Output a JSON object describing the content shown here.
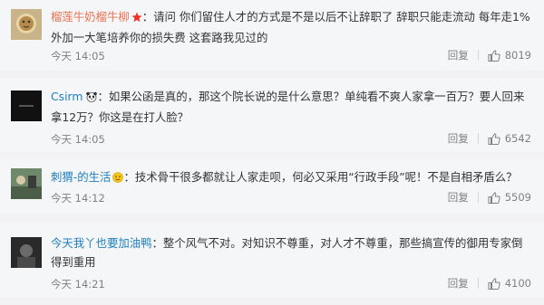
{
  "comments": [
    {
      "username": "榴莲牛奶榴牛柳",
      "badge_icon": "star-icon",
      "text": "请问 你们留住人才的方式是不是以后不让辞职了 辞职只能走流动 每年走1%外加一大笔培养你的损失费 这套路我见过的",
      "time": "今天 14:05",
      "reply_label": "回复",
      "likes": "8019"
    },
    {
      "username": "Csirm",
      "badge_icon": "panda-icon",
      "text": "如果公函是真的，那这个院长说的是什么意思？单纯看不爽人家拿一百万？要人回来拿12万？你这是在打人脸？",
      "time": "今天 14:05",
      "reply_label": "回复",
      "likes": "6542"
    },
    {
      "username": "刺猬-的生活",
      "badge_icon": "face-icon",
      "text": "技术骨干很多都就让人家走呗，何必又采用“行政手段”呢！不是自相矛盾么？",
      "time": "今天 14:12",
      "reply_label": "回复",
      "likes": "5509"
    },
    {
      "username": "今天我丫也要加油鸭",
      "text": "整个风气不对。对知识不尊重，对人才不尊重，那些搞宣传的御用专家倒得到重用",
      "time": "今天 14:21",
      "reply_label": "回复",
      "likes": "4100"
    }
  ],
  "colors": {
    "username_orange": "#eb7350",
    "username_blue": "#1e7fc0",
    "meta_gray": "#808080",
    "card_bg": "#f5f6f8",
    "page_bg": "#f2f2f5"
  }
}
